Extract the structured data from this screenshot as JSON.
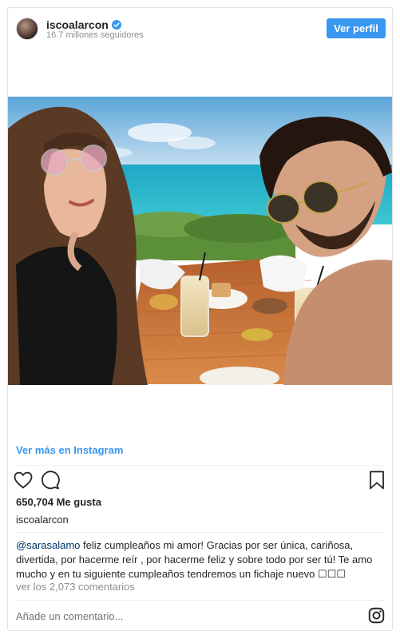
{
  "header": {
    "username": "iscoalarcon",
    "followers": "16.7 millones seguidores",
    "view_profile_label": "Ver perfil"
  },
  "post": {
    "image_alt": "Selfie de pareja en una mesa frente al mar",
    "see_more_label": "Ver más en Instagram",
    "likes": "650,704 Me gusta",
    "owner_username": "iscoalarcon",
    "caption_mention": "@sarasalamo",
    "caption_text": " feliz cumpleaños mi amor! Gracias por ser única, cariñosa, divertida, por hacerme reír , por hacerme feliz y sobre todo por ser tú! Te amo mucho y en tu siguiente cumpleaños tendremos un fichaje nuevo ☐☐☐",
    "comments_link": "ver los 2,073 comentarios",
    "comment_placeholder": "Añade un comentario..."
  },
  "icons": {
    "like": "heart-icon",
    "comment": "comment-bubble-icon",
    "save": "bookmark-icon",
    "brand": "instagram-icon",
    "verified": "verified-badge-icon"
  },
  "colors": {
    "accent": "#3897f0",
    "verified": "#3897f0",
    "text": "#262626",
    "muted": "#8e8e8e",
    "mention": "#003569"
  }
}
